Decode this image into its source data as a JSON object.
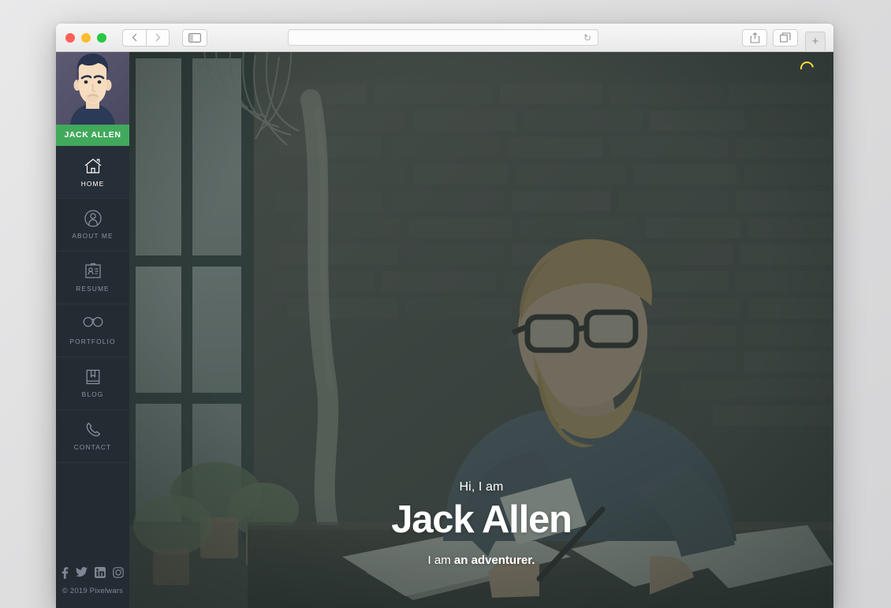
{
  "browser": {
    "traffic_lights": [
      "close",
      "minimize",
      "zoom"
    ],
    "back_label": "‹",
    "forward_label": "›",
    "sidebar_toggle_name": "sidebar-toggle",
    "url_value": "",
    "url_placeholder": "",
    "reload_label": "↻",
    "share_label": "share-icon",
    "tabs_label": "tabs-icon",
    "new_tab_label": "+"
  },
  "sidebar": {
    "profile_name": "JACK ALLEN",
    "avatar_alt": "avatar-illustration",
    "items": [
      {
        "label": "HOME",
        "icon": "home-icon",
        "active": true
      },
      {
        "label": "ABOUT ME",
        "icon": "user-circle-icon",
        "active": false
      },
      {
        "label": "RESUME",
        "icon": "id-card-icon",
        "active": false
      },
      {
        "label": "PORTFOLIO",
        "icon": "binoculars-icon",
        "active": false
      },
      {
        "label": "BLOG",
        "icon": "book-icon",
        "active": false
      },
      {
        "label": "CONTACT",
        "icon": "phone-icon",
        "active": false
      }
    ],
    "socials": [
      {
        "name": "facebook-icon",
        "glyph": "f"
      },
      {
        "name": "twitter-icon",
        "glyph": "t"
      },
      {
        "name": "linkedin-icon",
        "glyph": "in"
      },
      {
        "name": "instagram-icon",
        "glyph": "ig"
      }
    ],
    "copyright": "© 2019 Pixelwars"
  },
  "hero": {
    "greeting": "Hi, I am",
    "name": "Jack Allen",
    "tagline_prefix": "I am ",
    "tagline_role": "an adventurer.",
    "loading_indicator": "loading-spinner",
    "overlay_color": "#2e3d3a",
    "accent_color": "#41a95c",
    "spinner_color": "#f2e03a"
  }
}
